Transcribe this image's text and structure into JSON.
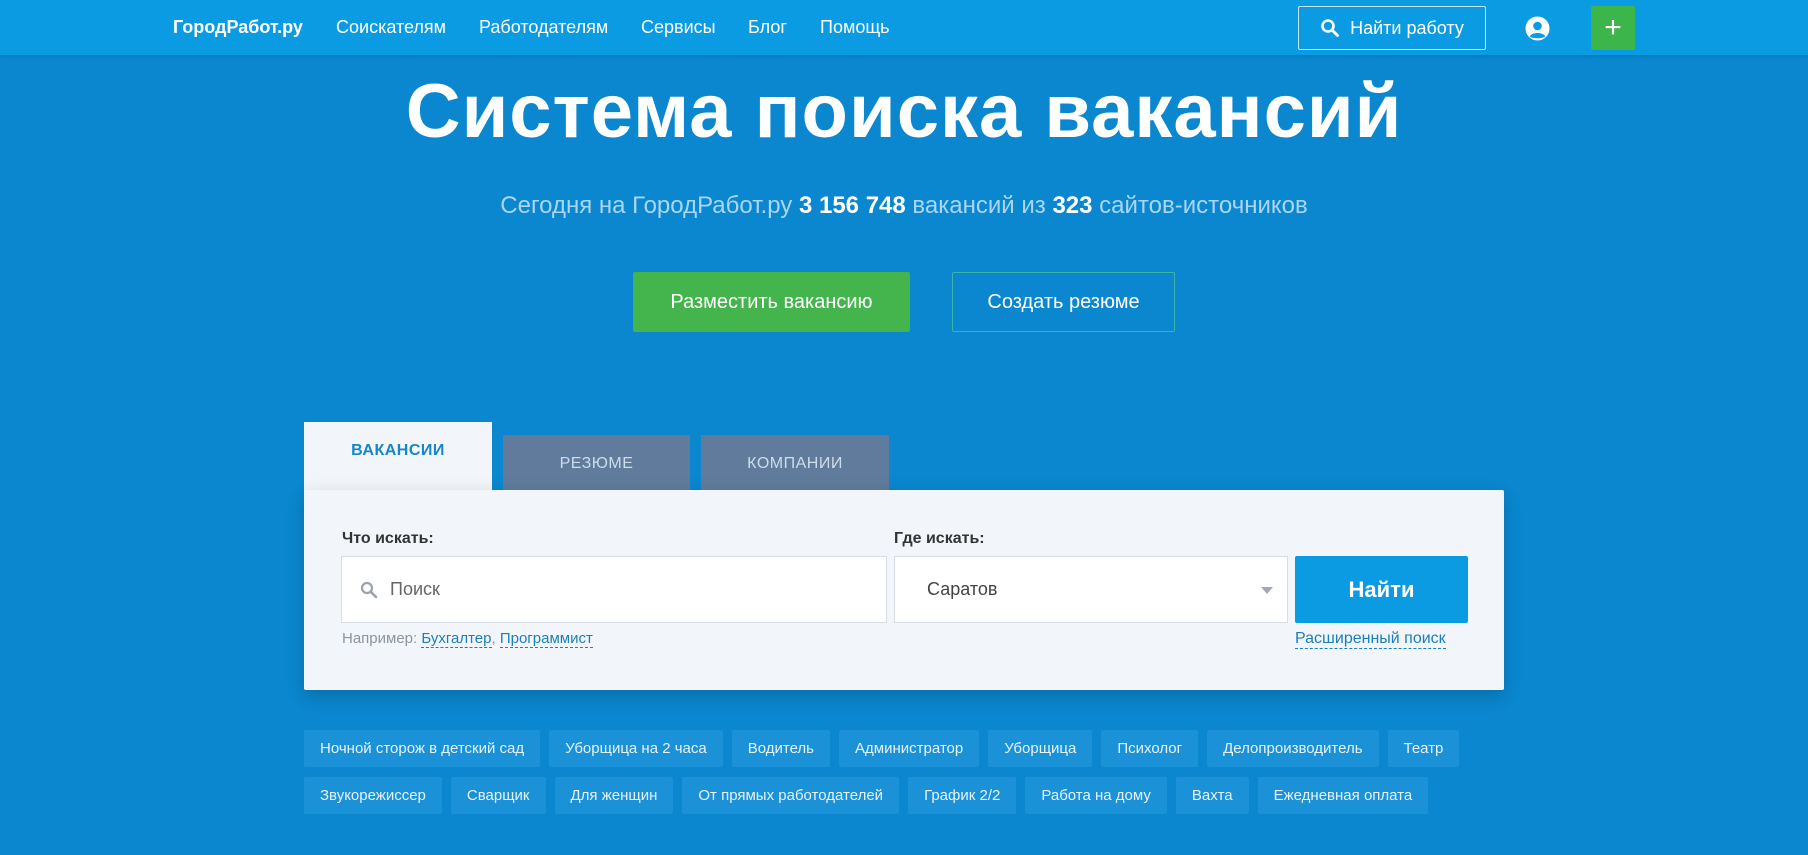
{
  "header": {
    "logo": "ГородРабот.ру",
    "nav": [
      "Соискателям",
      "Работодателям",
      "Сервисы",
      "Блог",
      "Помощь"
    ],
    "find_job_label": "Найти работу",
    "add_label": "+"
  },
  "hero": {
    "title": "Система поиска вакансий",
    "subtitle_prefix": "Сегодня на ГородРабот.ру",
    "vacancy_count": "3 156 748",
    "subtitle_mid": "вакансий из",
    "source_count": "323",
    "subtitle_suffix": "сайтов-источников",
    "post_vacancy_label": "Разместить вакансию",
    "create_resume_label": "Создать резюме"
  },
  "search": {
    "tabs": [
      "ВАКАНСИИ",
      "РЕЗЮМЕ",
      "КОМПАНИИ"
    ],
    "active_tab": "ВАКАНСИИ",
    "what_label": "Что искать:",
    "what_placeholder": "Поиск",
    "where_label": "Где искать:",
    "where_value": "Саратов",
    "find_label": "Найти",
    "examples_prefix": "Например:",
    "examples": [
      "Бухгалтер",
      "Программист"
    ],
    "advanced_label": "Расширенный поиск"
  },
  "tags": {
    "row1": [
      "Ночной сторож в детский сад",
      "Уборщица на 2 часа",
      "Водитель",
      "Администратор",
      "Уборщица",
      "Психолог",
      "Делопроизводитель",
      "Театр"
    ],
    "row2": [
      "Звукорежиссер",
      "Сварщик",
      "Для женщин",
      "От прямых работодателей",
      "График 2/2",
      "Работа на дому",
      "Вахта",
      "Ежедневная оплата"
    ]
  },
  "colors": {
    "background": "#0a87cf",
    "topbar": "#0b9be3",
    "accent_green": "#43b54c",
    "active_tab_text": "#1687c9"
  }
}
